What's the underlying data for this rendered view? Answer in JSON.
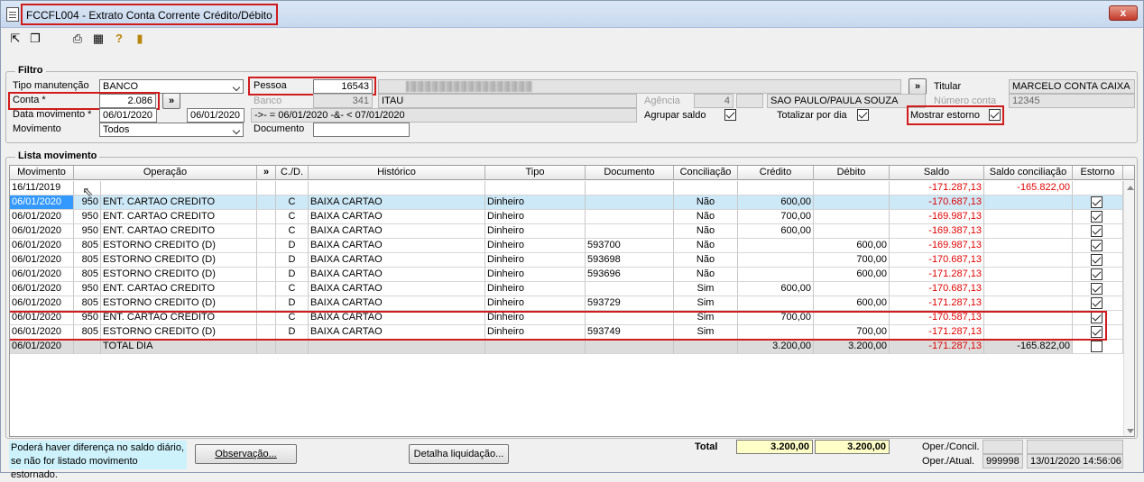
{
  "window": {
    "title": "FCCFL004 - Extrato Conta Corrente Crédito/Débito",
    "close": "x"
  },
  "toolbar": {
    "icons": [
      "arrow-out-icon",
      "copy-icon",
      "print-icon",
      "calendar-grid-icon",
      "help-icon",
      "exit-door-icon"
    ]
  },
  "filtro": {
    "label": "Filtro",
    "tipo_manutencao": {
      "label": "Tipo manutenção",
      "value": "BANCO"
    },
    "pessoa": {
      "label": "Pessoa",
      "value": "16543"
    },
    "titular": {
      "label": "Titular",
      "value": "MARCELO CONTA CAIXA"
    },
    "conta": {
      "label": "Conta *",
      "value": "2.086"
    },
    "banco": {
      "label": "Banco",
      "code": "341",
      "name": "ITAU"
    },
    "agencia": {
      "label": "Agência",
      "code": "4",
      "name": "SAO PAULO/PAULA SOUZA"
    },
    "numero_conta": {
      "label": "Número conta",
      "value": "12345"
    },
    "data_movimento": {
      "label": "Data movimento *",
      "from": "06/01/2020",
      "to": "06/01/2020",
      "expr": "->- = 06/01/2020 -&- < 07/01/2020"
    },
    "agrupar_saldo": {
      "label": "Agrupar saldo",
      "checked": true
    },
    "totalizar_por_dia": {
      "label": "Totalizar por dia",
      "checked": true
    },
    "mostrar_estorno": {
      "label": "Mostrar estorno",
      "checked": true
    },
    "movimento": {
      "label": "Movimento",
      "value": "Todos"
    },
    "documento": {
      "label": "Documento",
      "value": ""
    },
    "more_button": "»"
  },
  "lista": {
    "label": "Lista movimento",
    "columns": [
      "Movimento",
      "Operação",
      "»",
      "C./D.",
      "Histórico",
      "Tipo",
      "Documento",
      "Conciliação",
      "Crédito",
      "Débito",
      "Saldo",
      "Saldo conciliação",
      "Estorno"
    ],
    "opening": {
      "date": "16/11/2019",
      "saldo": "-171.287,13",
      "saldo_conc": "-165.822,00"
    },
    "rows": [
      {
        "mov": "06/01/2020",
        "code": "950",
        "op": "ENT. CARTAO CREDITO",
        "cd": "C",
        "hist": "BAIXA CARTAO",
        "tipo": "Dinheiro",
        "doc": "",
        "conc": "Não",
        "cred": "600,00",
        "deb": "",
        "saldo": "-170.687,13",
        "estorno": true
      },
      {
        "mov": "06/01/2020",
        "code": "950",
        "op": "ENT. CARTAO CREDITO",
        "cd": "C",
        "hist": "BAIXA CARTAO",
        "tipo": "Dinheiro",
        "doc": "",
        "conc": "Não",
        "cred": "700,00",
        "deb": "",
        "saldo": "-169.987,13",
        "estorno": true
      },
      {
        "mov": "06/01/2020",
        "code": "950",
        "op": "ENT. CARTAO CREDITO",
        "cd": "C",
        "hist": "BAIXA CARTAO",
        "tipo": "Dinheiro",
        "doc": "",
        "conc": "Não",
        "cred": "600,00",
        "deb": "",
        "saldo": "-169.387,13",
        "estorno": true
      },
      {
        "mov": "06/01/2020",
        "code": "805",
        "op": "ESTORNO CREDITO (D)",
        "cd": "D",
        "hist": "BAIXA CARTAO",
        "tipo": "Dinheiro",
        "doc": "593700",
        "conc": "Não",
        "cred": "",
        "deb": "600,00",
        "saldo": "-169.987,13",
        "estorno": true
      },
      {
        "mov": "06/01/2020",
        "code": "805",
        "op": "ESTORNO CREDITO (D)",
        "cd": "D",
        "hist": "BAIXA CARTAO",
        "tipo": "Dinheiro",
        "doc": "593698",
        "conc": "Não",
        "cred": "",
        "deb": "700,00",
        "saldo": "-170.687,13",
        "estorno": true
      },
      {
        "mov": "06/01/2020",
        "code": "805",
        "op": "ESTORNO CREDITO (D)",
        "cd": "D",
        "hist": "BAIXA CARTAO",
        "tipo": "Dinheiro",
        "doc": "593696",
        "conc": "Não",
        "cred": "",
        "deb": "600,00",
        "saldo": "-171.287,13",
        "estorno": true
      },
      {
        "mov": "06/01/2020",
        "code": "950",
        "op": "ENT. CARTAO CREDITO",
        "cd": "C",
        "hist": "BAIXA CARTAO",
        "tipo": "Dinheiro",
        "doc": "",
        "conc": "Sim",
        "cred": "600,00",
        "deb": "",
        "saldo": "-170.687,13",
        "estorno": true
      },
      {
        "mov": "06/01/2020",
        "code": "805",
        "op": "ESTORNO CREDITO (D)",
        "cd": "D",
        "hist": "BAIXA CARTAO",
        "tipo": "Dinheiro",
        "doc": "593729",
        "conc": "Sim",
        "cred": "",
        "deb": "600,00",
        "saldo": "-171.287,13",
        "estorno": true
      },
      {
        "mov": "06/01/2020",
        "code": "950",
        "op": "ENT. CARTAO CREDITO",
        "cd": "C",
        "hist": "BAIXA CARTAO",
        "tipo": "Dinheiro",
        "doc": "",
        "conc": "Sim",
        "cred": "700,00",
        "deb": "",
        "saldo": "-170.587,13",
        "estorno": true
      },
      {
        "mov": "06/01/2020",
        "code": "805",
        "op": "ESTORNO CREDITO (D)",
        "cd": "D",
        "hist": "BAIXA CARTAO",
        "tipo": "Dinheiro",
        "doc": "593749",
        "conc": "Sim",
        "cred": "",
        "deb": "700,00",
        "saldo": "-171.287,13",
        "estorno": true
      }
    ],
    "total": {
      "mov": "06/01/2020",
      "op": "TOTAL DIA",
      "cred": "3.200,00",
      "deb": "3.200,00",
      "saldo": "-171.287,13",
      "saldo_conc": "-165.822,00",
      "estorno": false
    }
  },
  "footer": {
    "note": "Poderá haver diferença no saldo diário, se não for listado movimento estornado.",
    "observacao": "Observação...",
    "detalha": "Detalha liquidação...",
    "total_label": "Total",
    "total_cred": "3.200,00",
    "total_deb": "3.200,00",
    "oper_concil_label": "Oper./Concil.",
    "oper_atual_label": "Oper./Atual.",
    "oper_atual_user": "999998",
    "oper_atual_date": "13/01/2020 14:56:06"
  },
  "colors": {
    "negative": "#e00000",
    "selection": "#3399ff",
    "highlight": "#d01c1c"
  }
}
